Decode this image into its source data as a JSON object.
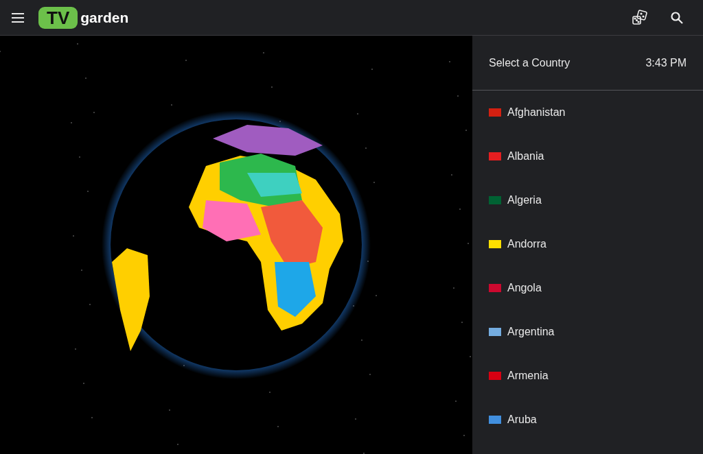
{
  "header": {
    "logo_badge": "TV",
    "logo_text": "garden"
  },
  "panel": {
    "title": "Select a Country",
    "time": "3:43 PM"
  },
  "countries": [
    {
      "name": "Afghanistan",
      "color": "#d32011"
    },
    {
      "name": "Albania",
      "color": "#e41e20"
    },
    {
      "name": "Algeria",
      "color": "#006233"
    },
    {
      "name": "Andorra",
      "color": "#fedf00"
    },
    {
      "name": "Angola",
      "color": "#cc092f"
    },
    {
      "name": "Argentina",
      "color": "#74acdf"
    },
    {
      "name": "Armenia",
      "color": "#d90012"
    },
    {
      "name": "Aruba",
      "color": "#418fde"
    }
  ]
}
